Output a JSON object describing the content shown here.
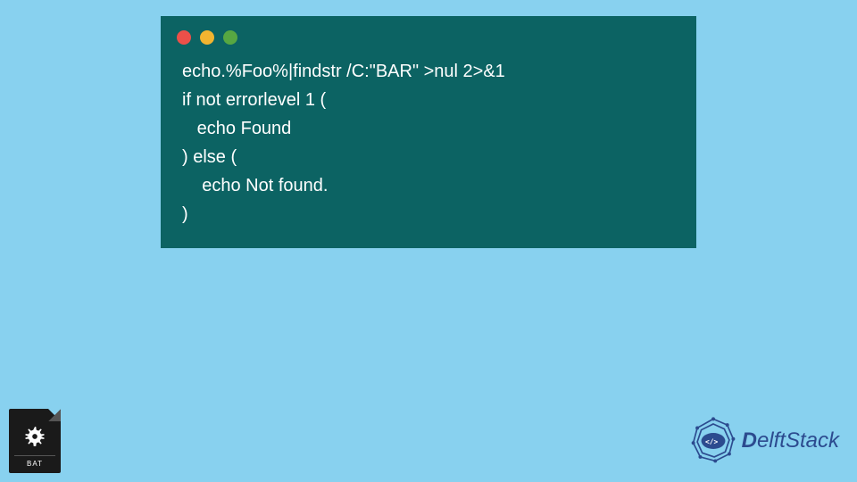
{
  "code": {
    "lines": [
      "echo.%Foo%|findstr /C:\"BAR\" >nul 2>&1",
      "if not errorlevel 1 (",
      "   echo Found",
      ") else (",
      "    echo Not found.",
      ")"
    ]
  },
  "bat_icon": {
    "label": "BAT"
  },
  "logo": {
    "text_prefix": "D",
    "text_rest": "elftStack"
  },
  "colors": {
    "background": "#88d1ef",
    "code_bg": "#0c6363",
    "code_fg": "#ffffff",
    "logo": "#2c4b8f"
  }
}
